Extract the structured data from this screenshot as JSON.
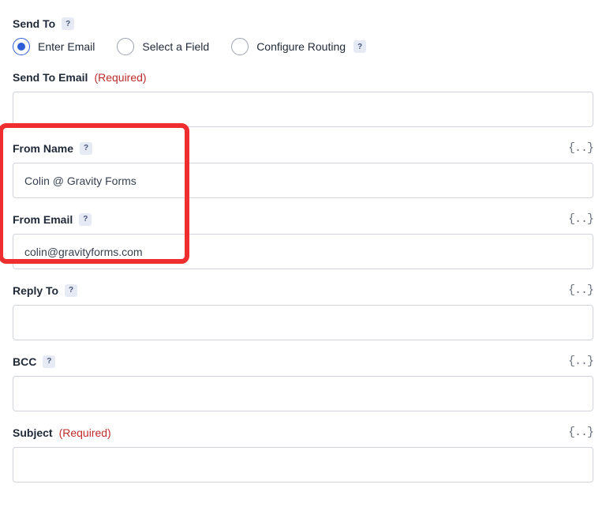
{
  "send_to": {
    "label": "Send To",
    "options": {
      "enter_email": "Enter Email",
      "select_field": "Select a Field",
      "configure_routing": "Configure Routing"
    }
  },
  "send_to_email": {
    "label": "Send To Email",
    "required_text": "(Required)",
    "value": ""
  },
  "from_name": {
    "label": "From Name",
    "value": "Colin @ Gravity Forms"
  },
  "from_email": {
    "label": "From Email",
    "value": "colin@gravityforms.com"
  },
  "reply_to": {
    "label": "Reply To",
    "value": ""
  },
  "bcc": {
    "label": "BCC",
    "value": ""
  },
  "subject": {
    "label": "Subject",
    "required_text": "(Required)",
    "value": ""
  },
  "icons": {
    "help": "?",
    "merge": "{..}"
  }
}
